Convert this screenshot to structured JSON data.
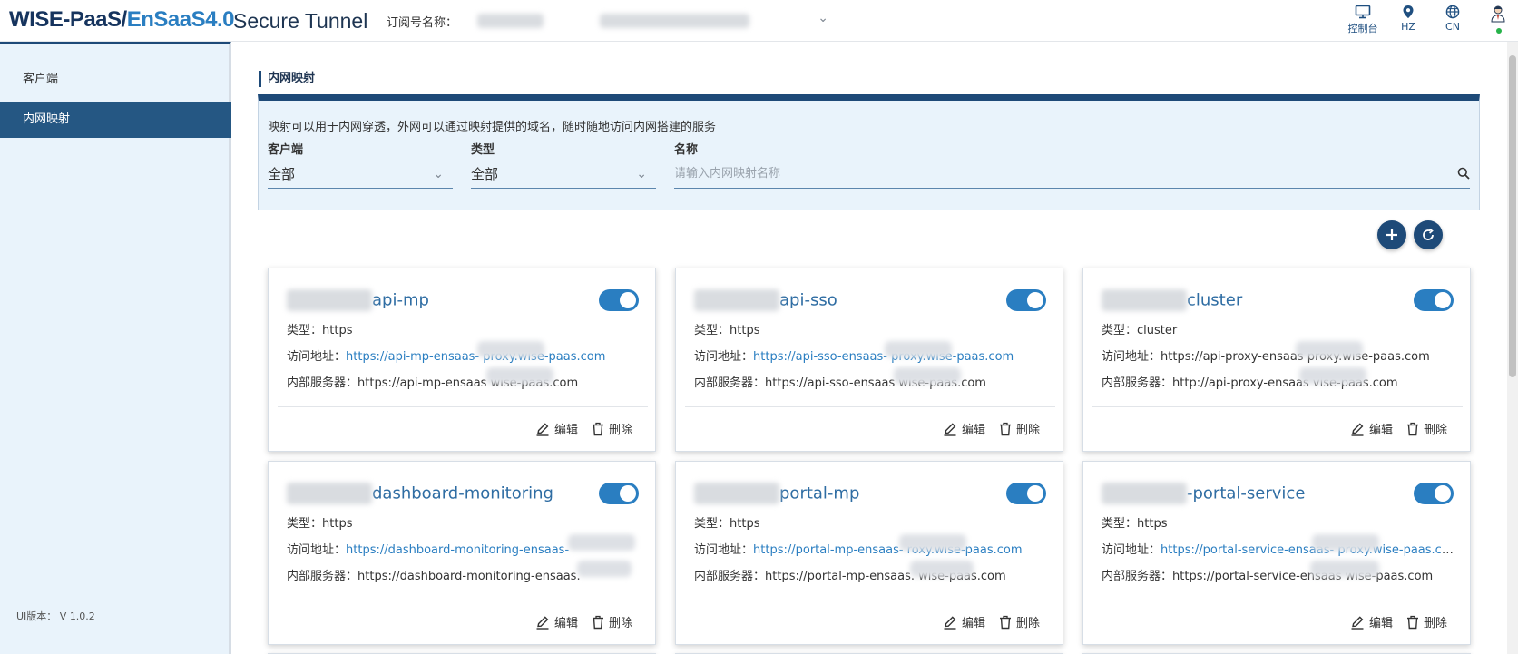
{
  "header": {
    "logo_left": "WISE-PaaS/",
    "logo_right": "EnSaaS4.0",
    "app_title": "Secure Tunnel",
    "subscription_label": "订阅号名称：",
    "icons": [
      {
        "name": "monitor-icon",
        "label": "控制台"
      },
      {
        "name": "location-icon",
        "label": "HZ"
      },
      {
        "name": "globe-icon",
        "label": "CN"
      },
      {
        "name": "user-icon",
        "label": ""
      }
    ]
  },
  "sidebar": {
    "items": [
      {
        "label": "客户端",
        "active": false
      },
      {
        "label": "内网映射",
        "active": true
      }
    ],
    "version": "UI版本：     V 1.0.2"
  },
  "main": {
    "title": "内网映射",
    "description": "映射可以用于内网穿透，外网可以通过映射提供的域名，随时随地访问内网搭建的服务",
    "filters": {
      "client_label": "客户端",
      "client_value": "全部",
      "type_label": "类型",
      "type_value": "全部",
      "name_label": "名称",
      "name_placeholder": "请输入内网映射名称"
    },
    "actions": {
      "add_icon": "plus-icon",
      "refresh_icon": "refresh-icon"
    }
  },
  "labels": {
    "type": "类型：",
    "access": "访问地址：",
    "internal": "内部服务器：",
    "edit": "编辑",
    "delete": "删除"
  },
  "cards": [
    {
      "title": "api-mp",
      "type": "https",
      "access": "https://api-mp-ensaas-              proxy.wise-paas.com",
      "internal": "https://api-mp-ensaas              wise-paas.com",
      "enabled": true
    },
    {
      "title": "api-sso",
      "type": "https",
      "access": "https://api-sso-ensaas-              proxy.wise-paas.com",
      "internal": "https://api-sso-ensaas              wise-paas.com",
      "enabled": true
    },
    {
      "title": "cluster",
      "type": "cluster",
      "access": "https://api-proxy-ensaas              proxy.wise-paas.com",
      "internal": "http://api-proxy-ensaas              vise-paas.com",
      "enabled": true
    },
    {
      "title": "dashboard-monitoring",
      "type": "https",
      "access": "https://dashboard-monitoring-ensaas-              ",
      "internal": "https://dashboard-monitoring-ensaas.              ",
      "enabled": true
    },
    {
      "title": "portal-mp",
      "type": "https",
      "access": "https://portal-mp-ensaas-              roxy.wise-paas.com",
      "internal": "https://portal-mp-ensaas.              wise-paas.com",
      "enabled": true
    },
    {
      "title": "-portal-service",
      "type": "https",
      "access": "https://portal-service-ensaas-              proxy.wise-paas.com",
      "internal": "https://portal-service-ensaas              wise-paas.com",
      "enabled": true
    }
  ],
  "colors": {
    "primary": "#1e4a78",
    "accent": "#2a7ec1",
    "sidebar_bg": "#e9f3fb",
    "sidebar_active": "#255783"
  }
}
